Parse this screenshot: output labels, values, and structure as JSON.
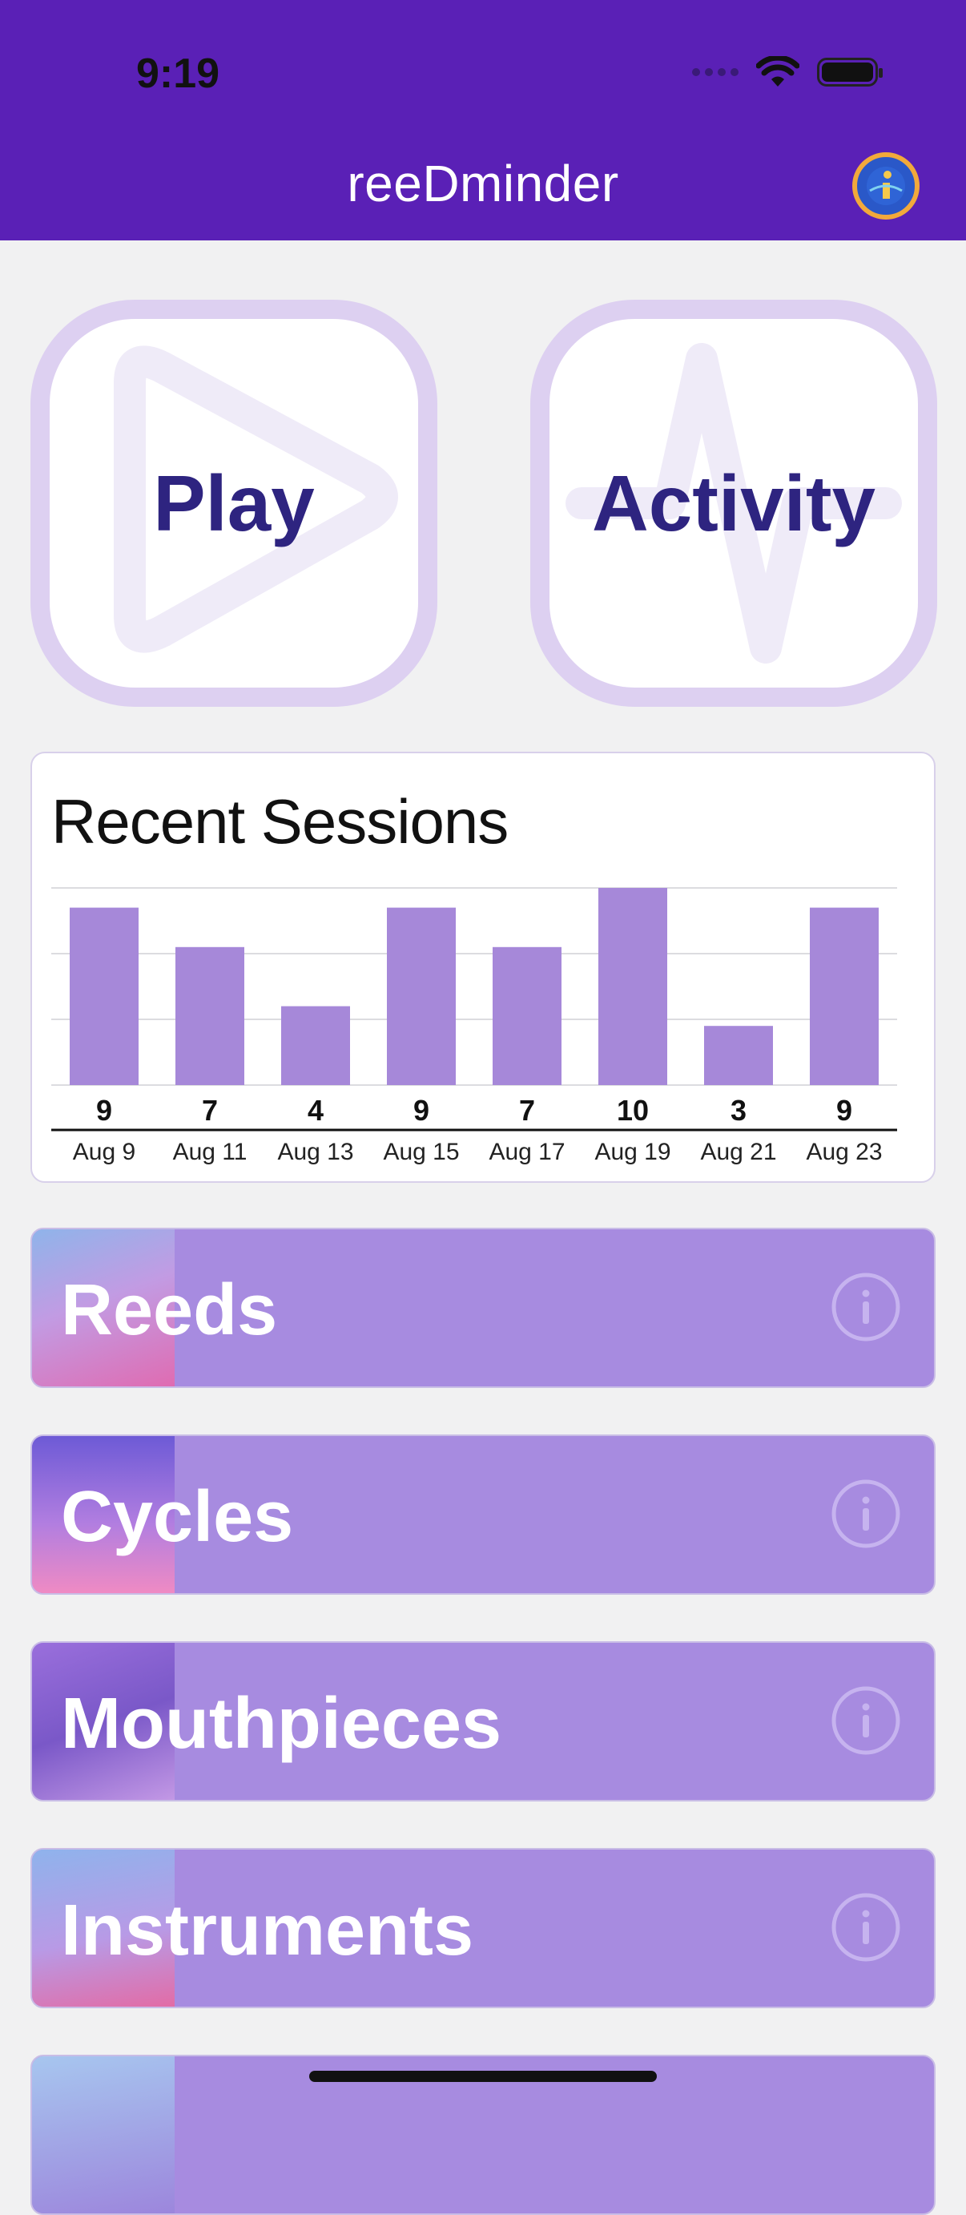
{
  "status_bar": {
    "time": "9:19"
  },
  "header": {
    "title": "reeDminder"
  },
  "tiles": {
    "play_label": "Play",
    "activity_label": "Activity"
  },
  "recent_sessions": {
    "title": "Recent Sessions"
  },
  "chart_data": {
    "type": "bar",
    "title": "Recent Sessions",
    "categories": [
      "Aug 9",
      "Aug 11",
      "Aug 13",
      "Aug 15",
      "Aug 17",
      "Aug 19",
      "Aug 21",
      "Aug 23"
    ],
    "values": [
      9,
      7,
      4,
      9,
      7,
      10,
      3,
      9
    ],
    "ylim": [
      0,
      10
    ],
    "grid": true,
    "bar_color": "#a688d9"
  },
  "list": {
    "items": [
      {
        "label": "Reeds"
      },
      {
        "label": "Cycles"
      },
      {
        "label": "Mouthpieces"
      },
      {
        "label": "Instruments"
      }
    ]
  },
  "colors": {
    "header": "#5a20b6",
    "tile_border": "#ddd0f1",
    "tile_text": "#2e2480",
    "row_background": "#a78be0"
  }
}
